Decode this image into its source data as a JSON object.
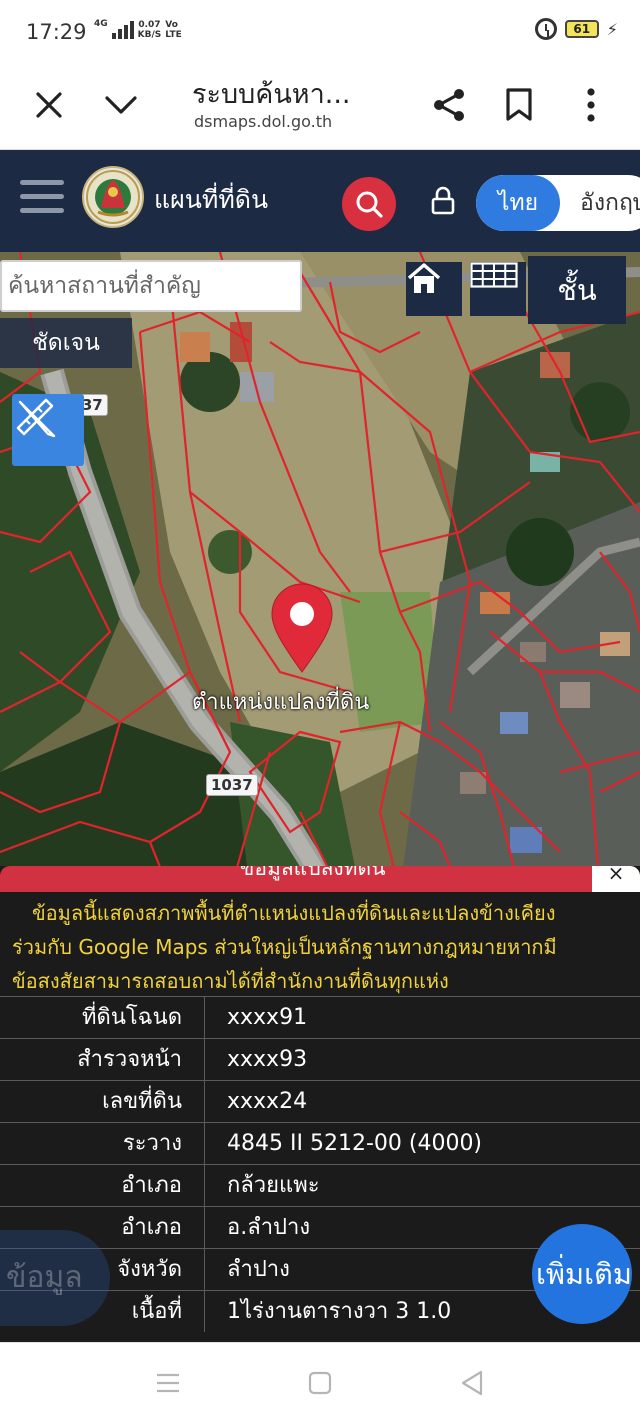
{
  "status_bar": {
    "time": "17:29",
    "network": "4G",
    "speed": "0.07\nKB/S",
    "volte": "Vo\nLTE",
    "battery": "61"
  },
  "browser": {
    "title": "ระบบค้นหา...",
    "url": "dsmaps.dol.go.th"
  },
  "app": {
    "title": "แผนที่ที่ดิน",
    "lang_th": "ไทย",
    "lang_en": "อังกฤษ"
  },
  "map": {
    "search_placeholder": "ค้นหาสถานที่สำคัญ",
    "layer_label": "ชั้น",
    "clear_label": "ชัดเจน",
    "road_number": "1037",
    "pin_label": "ตำแหน่งแปลงที่ดิน"
  },
  "info": {
    "header": "ข้อมูลแปลงที่ดิน",
    "close": "×",
    "note_line1": "ข้อมูลนี้แสดงสภาพพื้นที่ตำแหน่งแปลงที่ดินและแปลงข้างเคียง",
    "note_line2": "ร่วมกับ Google Maps ส่วนใหญ่เป็นหลักฐานทางกฎหมายหากมี",
    "note_line3": "ข้อสงสัยสามารถสอบถามได้ที่สำนักงานที่ดินทุกแห่ง",
    "rows": [
      {
        "key": "ที่ดินโฉนด",
        "value": "xxxx91"
      },
      {
        "key": "สำรวจหน้า",
        "value": "xxxx93"
      },
      {
        "key": "เลขที่ดิน",
        "value": "xxxx24"
      },
      {
        "key": "ระวาง",
        "value": "4845 II 5212-00 (4000)"
      },
      {
        "key": "อำเภอ",
        "value": "กล้วยแพะ"
      },
      {
        "key": "อำเภอ",
        "value": "อ.ลำปาง"
      },
      {
        "key": "จังหวัด",
        "value": "ลำปาง"
      },
      {
        "key": "เนื้อที่",
        "value": "1ไร่งานตารางวา 3 1.0"
      }
    ],
    "side_left_label": "ข้อมูล",
    "add_label": "เพิ่มเติม"
  },
  "colors": {
    "header_navy": "#1c2a44",
    "search_red": "#d8303e",
    "lang_blue": "#2f7be0",
    "parcel_red": "#e0242c",
    "note_yellow": "#f0d23d"
  }
}
